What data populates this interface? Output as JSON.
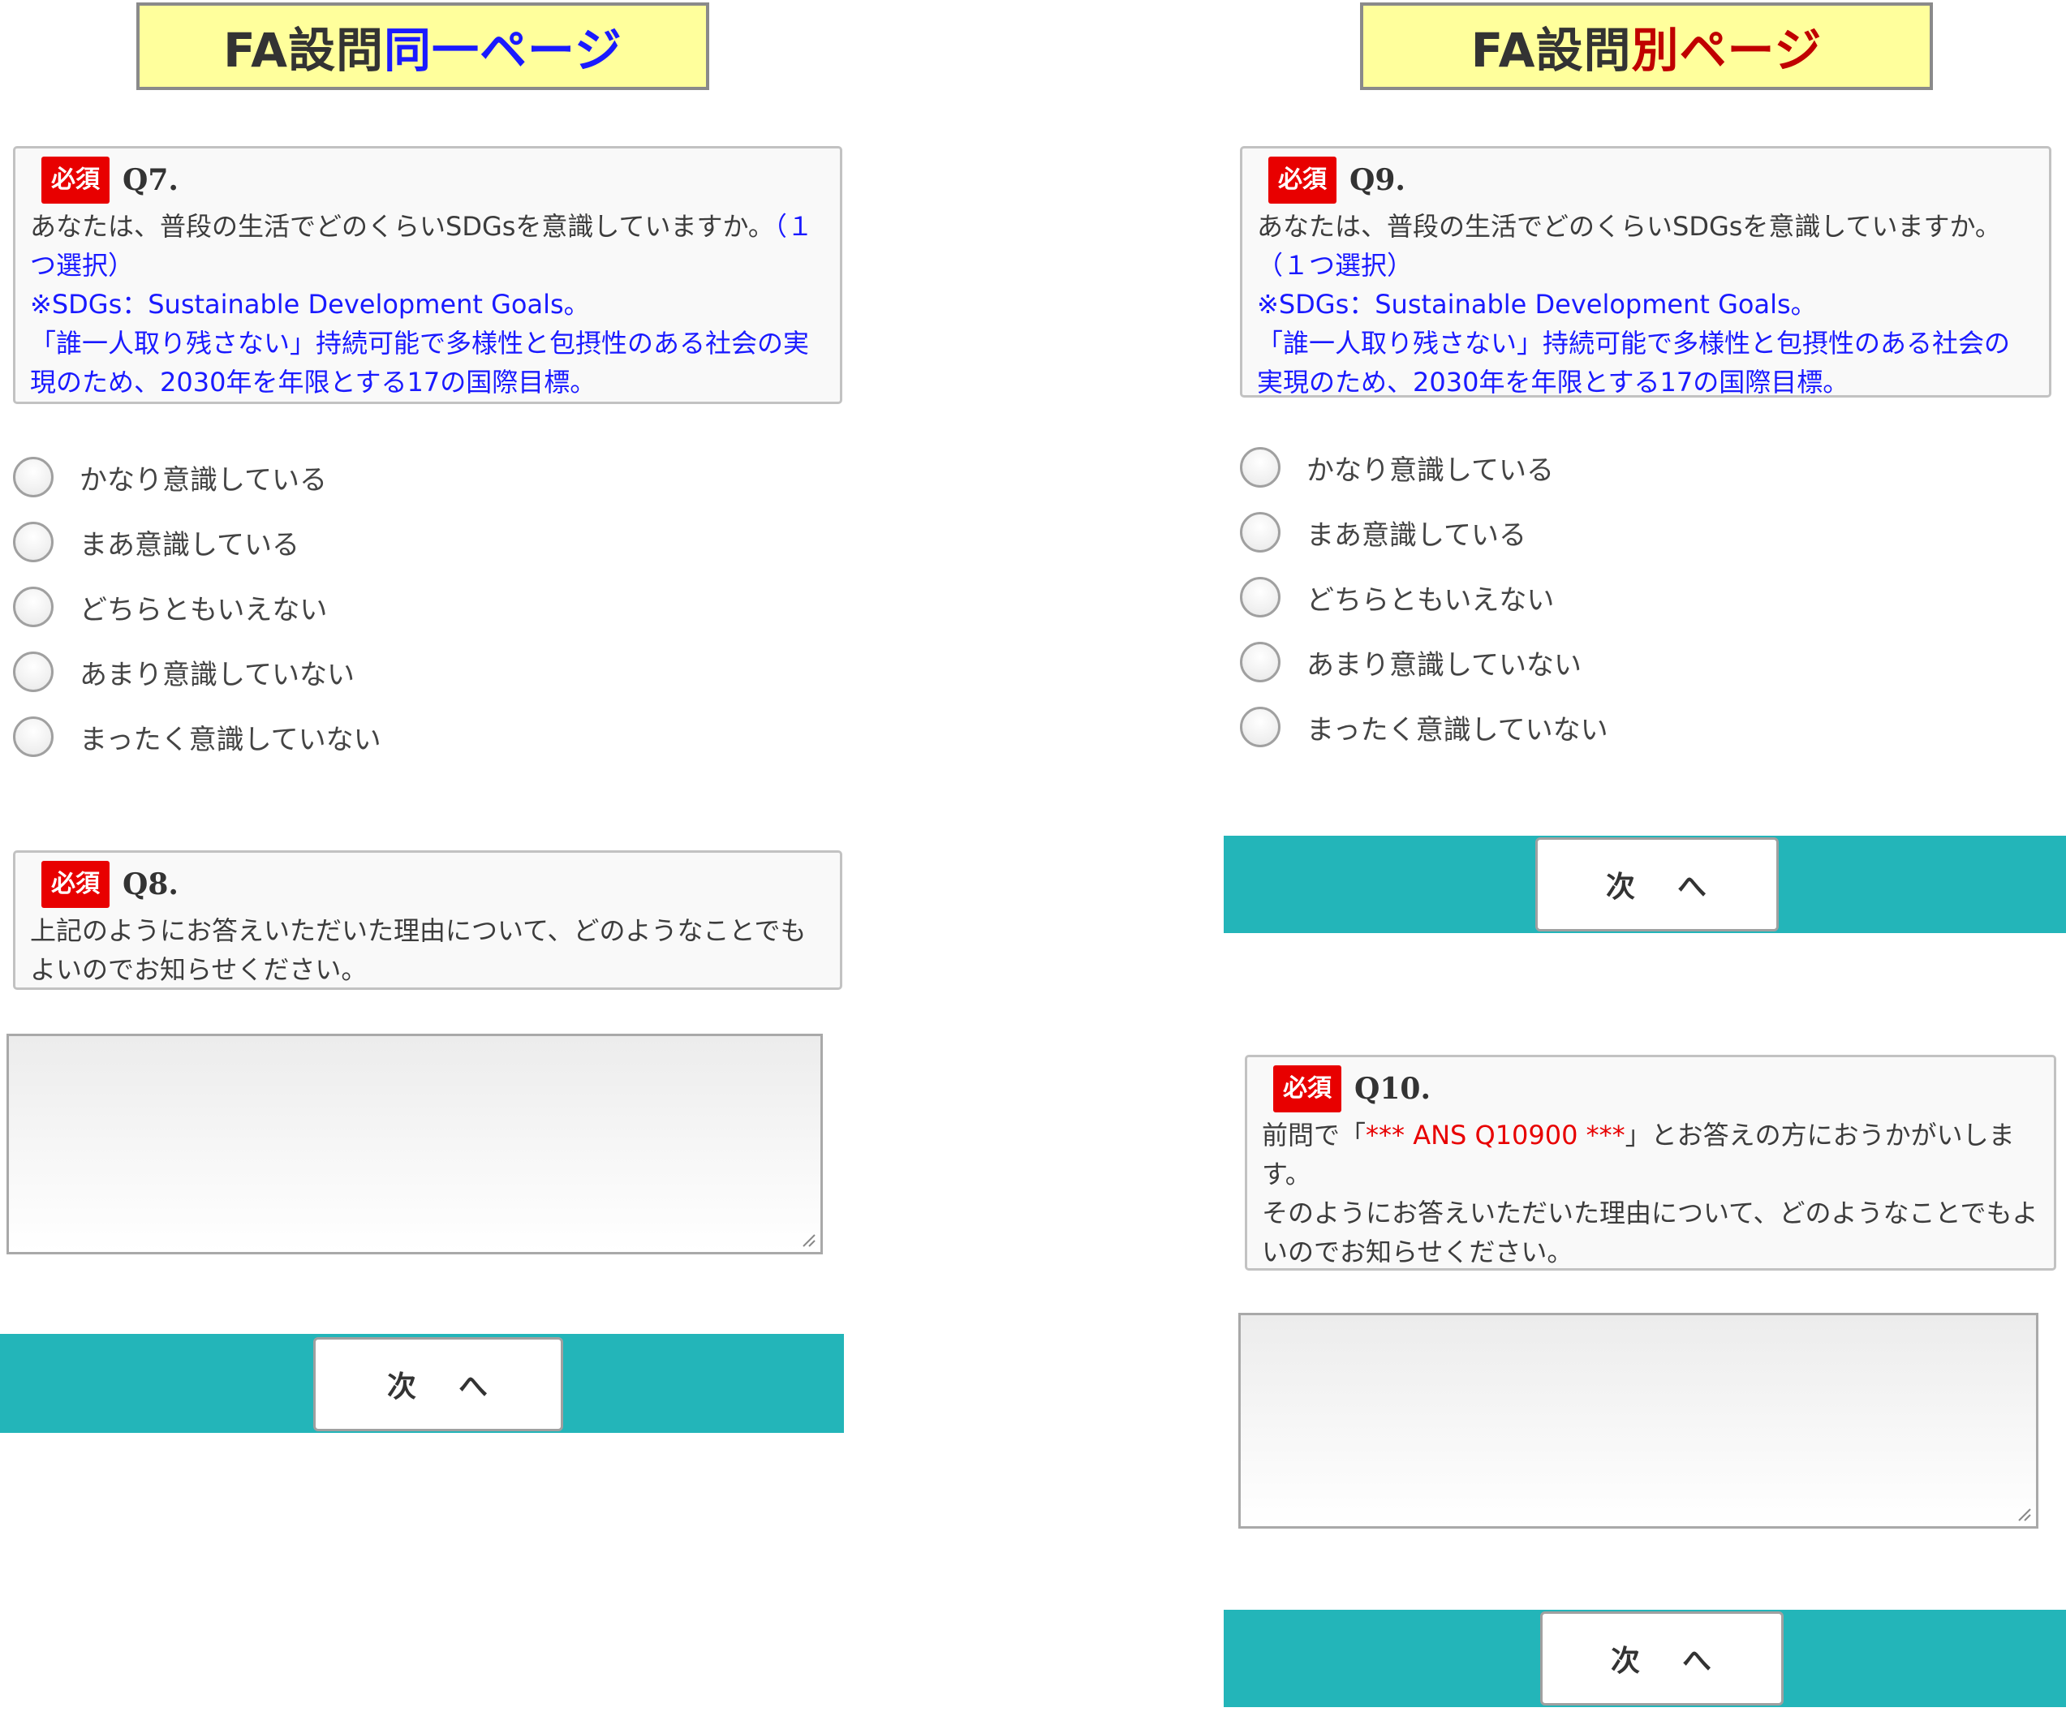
{
  "left_title": {
    "prefix": "FA設問",
    "accent": "同一ページ"
  },
  "right_title": {
    "prefix": "FA設問",
    "accent": "別ページ"
  },
  "q7": {
    "badge": "必須",
    "number": "Q7.",
    "text": "あなたは、普段の生活でどのくらいSDGsを意識していますか。",
    "instruction": "（１つ選択）",
    "note_line1": "※SDGs：Sustainable Development Goals。",
    "note_line2": "「誰一人取り残さない」持続可能で多様性と包摂性のある社会の実現のため、2030年を年限とする17の国際目標。",
    "options": [
      "かなり意識している",
      "まあ意識している",
      "どちらともいえない",
      "あまり意識していない",
      "まったく意識していない"
    ]
  },
  "q8": {
    "badge": "必須",
    "number": "Q8.",
    "text": "上記のようにお答えいただいた理由について、どのようなことでもよいのでお知らせください。",
    "textarea_value": ""
  },
  "q9": {
    "badge": "必須",
    "number": "Q9.",
    "text": "あなたは、普段の生活でどのくらいSDGsを意識していますか。",
    "instruction": "（１つ選択）",
    "note_line1": "※SDGs：Sustainable Development Goals。",
    "note_line2": "「誰一人取り残さない」持続可能で多様性と包摂性のある社会の実現のため、2030年を年限とする17の国際目標。",
    "options": [
      "かなり意識している",
      "まあ意識している",
      "どちらともいえない",
      "あまり意識していない",
      "まったく意識していない"
    ]
  },
  "q10": {
    "badge": "必須",
    "number": "Q10.",
    "text_before": "前問で「",
    "piped_answer": "*** ANS Q10900 ***",
    "text_after": "」とお答えの方におうかがいします。",
    "text_line2": "そのようにお答えいただいた理由について、どのようなことでもよいのでお知らせください。",
    "textarea_value": ""
  },
  "buttons": {
    "next_char1": "次",
    "next_char2": "へ"
  },
  "colors": {
    "navbar": "#23b5b9",
    "badge": "#e80000",
    "title_bg": "#ffff9c",
    "accent_blue": "#1a1aff",
    "accent_red": "#c00000"
  }
}
